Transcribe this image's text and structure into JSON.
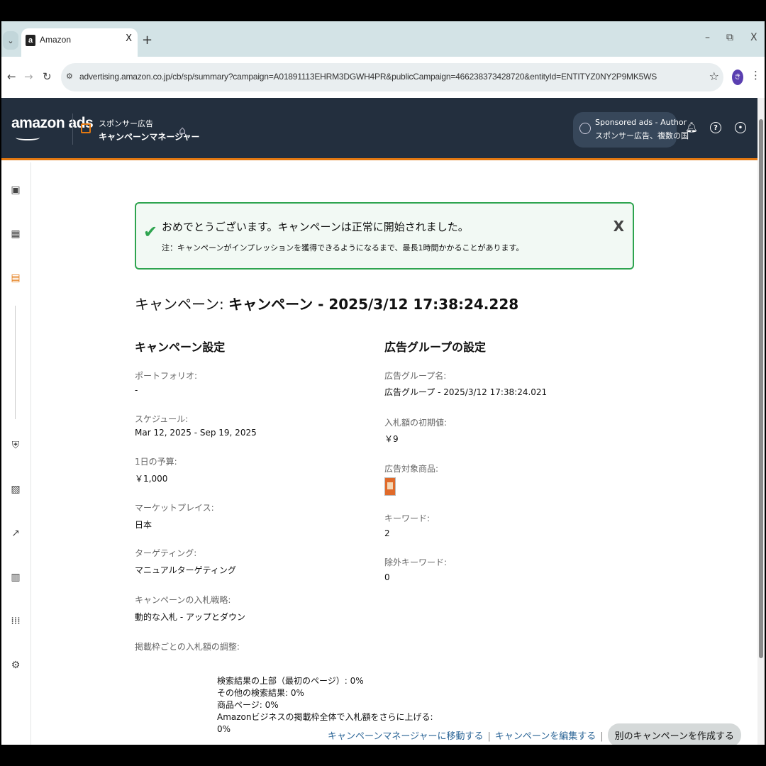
{
  "browser": {
    "tab_title": "Amazon",
    "tab_close": "X",
    "new_tab": "+",
    "favicon": "a",
    "url": "advertising.amazon.co.jp/cb/sp/summary?campaign=A01891113EHRM3DGWH4PR&publicCampaign=466238373428720&entityId=ENTITYZ0NY2P9MK5WS",
    "window_controls": {
      "minimize": "–",
      "restore": "⧉",
      "close": "X"
    },
    "profile_initial": "き"
  },
  "header": {
    "logo": "amazon ads",
    "product_top": "スポンサー広告",
    "product_bottom": "キャンペーンマネージャー",
    "account_top": "Sponsored ads - Author",
    "account_bottom": "スポンサー広告、複数の国"
  },
  "alert": {
    "title": "おめでとうございます。キャンペーンは正常に開始されました。",
    "subtitle": "注：キャンペーンがインプレッションを獲得できるようになるまで、最長1時間かかることがあります。",
    "close": "X"
  },
  "page_title": {
    "label": "キャンペーン: ",
    "value": "キャンペーン - 2025/3/12 17:38:24.228"
  },
  "campaign_settings": {
    "heading": "キャンペーン設定",
    "portfolio_label": "ポートフォリオ:",
    "portfolio_value": "-",
    "schedule_label": "スケジュール:",
    "schedule_value": "Mar 12, 2025 - Sep 19, 2025",
    "budget_label": "1日の予算:",
    "budget_value": "￥1,000",
    "marketplace_label": "マーケットプレイス:",
    "marketplace_value": "日本",
    "targeting_label": "ターゲティング:",
    "targeting_value": "マニュアルターゲティング",
    "bidding_label": "キャンペーンの入札戦略:",
    "bidding_value": "動的な入札 - アップとダウン",
    "placement_label": "掲載枠ごとの入札額の調整:",
    "placement_values": [
      "検索結果の上部（最初のページ）: 0%",
      "その他の検索結果: 0%",
      "商品ページ: 0%",
      "Amazonビジネスの掲載枠全体で入札額をさらに上げる:",
      "0%"
    ]
  },
  "adgroup_settings": {
    "heading": "広告グループの設定",
    "name_label": "広告グループ名:",
    "name_value": "広告グループ - 2025/3/12 17:38:24.021",
    "default_bid_label": "入札額の初期値:",
    "default_bid_value": "￥9",
    "products_label": "広告対象商品:",
    "keywords_label": "キーワード:",
    "keywords_value": "2",
    "negative_keywords_label": "除外キーワード:",
    "negative_keywords_value": "0"
  },
  "footer": {
    "link_manager": "キャンペーンマネージャーに移動する",
    "link_edit": "キャンペーンを編集する",
    "button_create": "別のキャンペーンを作成する",
    "separator": "|"
  },
  "colors": {
    "header_bg": "#232f3e",
    "accent": "#e47911",
    "success": "#2ea44f",
    "link": "#2a6496"
  }
}
